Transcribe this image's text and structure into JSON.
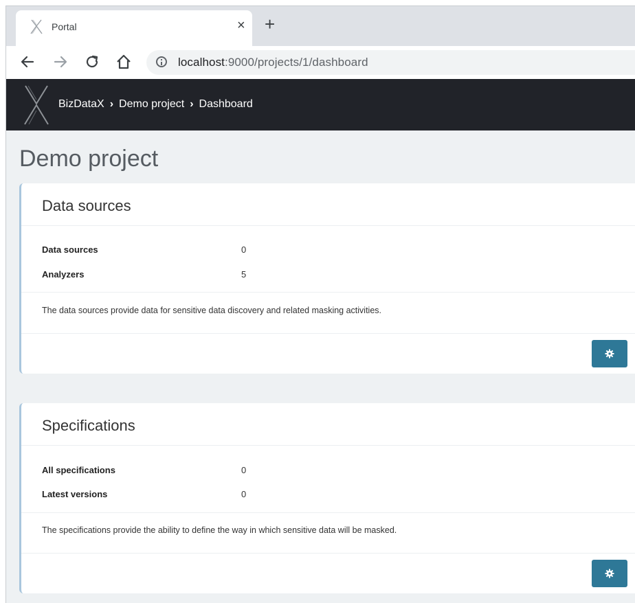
{
  "browser": {
    "tab_title": "Portal",
    "close_glyph": "×",
    "new_tab_glyph": "+",
    "url_host": "localhost",
    "url_path": ":9000/projects/1/dashboard"
  },
  "header": {
    "breadcrumbs": [
      "BizDataX",
      "Demo project",
      "Dashboard"
    ],
    "separator": "›"
  },
  "page": {
    "title": "Demo project"
  },
  "cards": [
    {
      "title": "Data sources",
      "stats": [
        {
          "label": "Data sources",
          "value": "0"
        },
        {
          "label": "Analyzers",
          "value": "5"
        }
      ],
      "description": "The data sources provide data for sensitive data discovery and related masking activities.",
      "button_icon": "gear-icon"
    },
    {
      "title": "Specifications",
      "stats": [
        {
          "label": "All specifications",
          "value": "0"
        },
        {
          "label": "Latest versions",
          "value": "0"
        }
      ],
      "description": "The specifications provide the ability to define the way in which sensitive data will be masked.",
      "button_icon": "gear-icon"
    }
  ],
  "colors": {
    "header_bg": "#212329",
    "accent": "#2e7897",
    "card_border": "#a9c6dd",
    "page_bg": "#eef1f3"
  }
}
